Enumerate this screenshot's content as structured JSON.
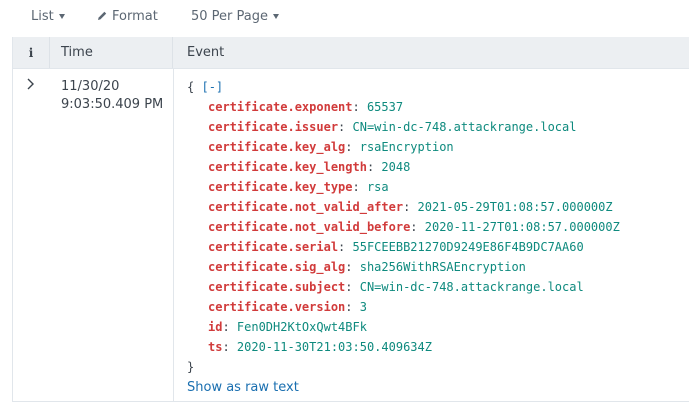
{
  "toolbar": {
    "list_label": "List",
    "format_label": "Format",
    "per_page_label": "50 Per Page"
  },
  "table": {
    "headers": {
      "info": "i",
      "time": "Time",
      "event": "Event"
    },
    "row": {
      "time_date": "11/30/20",
      "time_clock": "9:03:50.409 PM",
      "open_brace": "{",
      "collapse_label": "[-]",
      "close_brace": "}",
      "fields": [
        {
          "key": "certificate.exponent",
          "value": "65537"
        },
        {
          "key": "certificate.issuer",
          "value": "CN=win-dc-748.attackrange.local"
        },
        {
          "key": "certificate.key_alg",
          "value": "rsaEncryption"
        },
        {
          "key": "certificate.key_length",
          "value": "2048"
        },
        {
          "key": "certificate.key_type",
          "value": "rsa"
        },
        {
          "key": "certificate.not_valid_after",
          "value": "2021-05-29T01:08:57.000000Z"
        },
        {
          "key": "certificate.not_valid_before",
          "value": "2020-11-27T01:08:57.000000Z"
        },
        {
          "key": "certificate.serial",
          "value": "55FCEEBB21270D9249E86F4B9DC7AA60"
        },
        {
          "key": "certificate.sig_alg",
          "value": "sha256WithRSAEncryption"
        },
        {
          "key": "certificate.subject",
          "value": "CN=win-dc-748.attackrange.local"
        },
        {
          "key": "certificate.version",
          "value": "3"
        },
        {
          "key": "id",
          "value": "Fen0DH2KtOxQwt4BFk"
        },
        {
          "key": "ts",
          "value": "2020-11-30T21:03:50.409634Z"
        }
      ],
      "raw_link": "Show as raw text"
    }
  },
  "colors": {
    "key": "#d13b3b",
    "value": "#0e8a7e",
    "link": "#1a6fb0",
    "header_bg": "#eceff2"
  }
}
